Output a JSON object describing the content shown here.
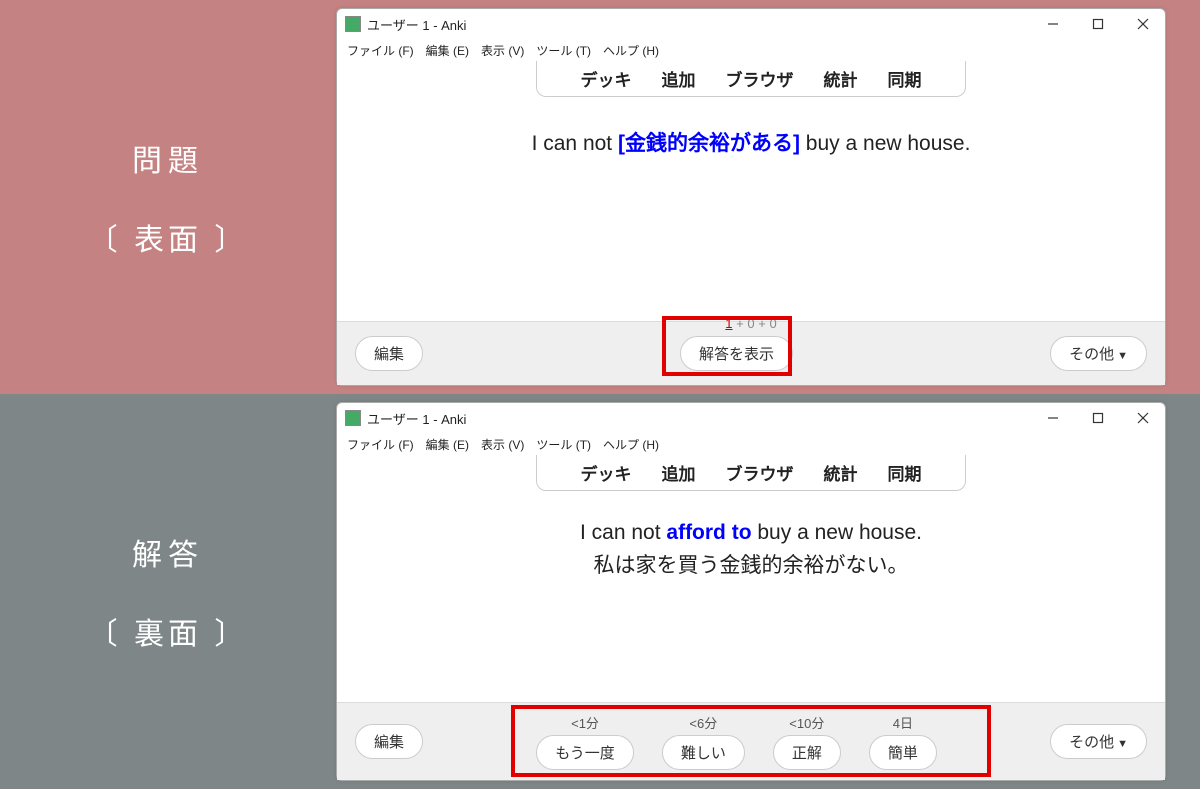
{
  "sideLabels": {
    "top_line1": "問題",
    "top_line2": "〔 表面 〕",
    "bottom_line1": "解答",
    "bottom_line2": "〔 裏面 〕"
  },
  "titlebar": {
    "title": "ユーザー 1 - Anki"
  },
  "menubar": {
    "file": "ファイル (F)",
    "edit": "編集 (E)",
    "view": "表示 (V)",
    "tools": "ツール (T)",
    "help": "ヘルプ (H)"
  },
  "toolbar": {
    "deck": "デッキ",
    "add": "追加",
    "browser": "ブラウザ",
    "stats": "統計",
    "sync": "同期"
  },
  "front": {
    "pre": "I can not ",
    "cloze": "[金銭的余裕がある]",
    "post": " buy a new house."
  },
  "back": {
    "pre": "I can not ",
    "answer": "afford to",
    "post": " buy a new house.",
    "translation": "私は家を買う金銭的余裕がない。"
  },
  "counts": {
    "new": "1",
    "learn": "0",
    "due": "0"
  },
  "bottombar": {
    "edit": "編集",
    "show_answer": "解答を表示",
    "other": "その他"
  },
  "answer_buttons": {
    "again_time": "<1分",
    "again": "もう一度",
    "hard_time": "<6分",
    "hard": "難しい",
    "good_time": "<10分",
    "good": "正解",
    "easy_time": "4日",
    "easy": "簡単"
  }
}
